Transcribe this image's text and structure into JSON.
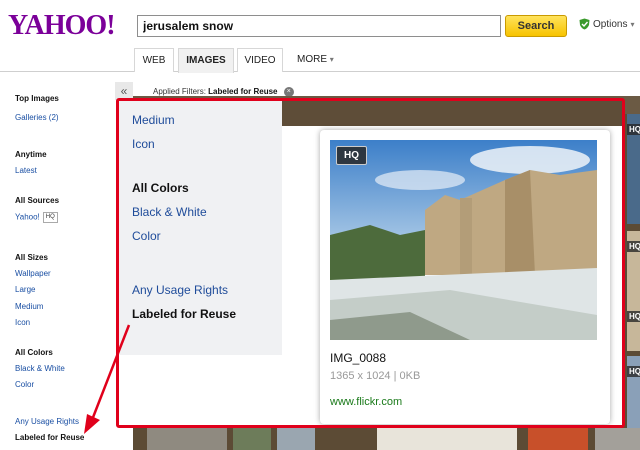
{
  "header": {
    "logo": "YAHOO!",
    "search_value": "jerusalem snow",
    "search_button": "Search",
    "options": "Options",
    "options_caret": "▾"
  },
  "tabs": [
    {
      "label": "WEB"
    },
    {
      "label": "IMAGES"
    },
    {
      "label": "VIDEO"
    }
  ],
  "more_tab": "MORE",
  "more_caret": "▾",
  "collapse_glyph": "«",
  "sidebar": {
    "top_images": "Top Images",
    "galleries": "Galleries (2)",
    "anytime": "Anytime",
    "latest": "Latest",
    "all_sources": "All Sources",
    "yahoo": "Yahoo!",
    "hq": "HQ",
    "all_sizes": "All Sizes",
    "wallpaper": "Wallpaper",
    "large": "Large",
    "medium": "Medium",
    "icon": "Icon",
    "all_colors": "All Colors",
    "black_white": "Black & White",
    "color": "Color",
    "any_usage": "Any Usage Rights",
    "labeled_reuse": "Labeled for Reuse"
  },
  "filters": {
    "label": "Applied Filters:",
    "value": "Labeled for Reuse",
    "close": "×"
  },
  "zoom_menu": {
    "medium": "Medium",
    "icon": "Icon",
    "all_colors": "All Colors",
    "black_white": "Black & White",
    "color": "Color",
    "any_usage": "Any Usage Rights",
    "labeled_reuse": "Labeled for Reuse"
  },
  "card": {
    "hq": "HQ",
    "title": "IMG_0088",
    "meta": "1365 x 1024 | 0KB",
    "url": "www.flickr.com"
  },
  "right_hq": [
    "HQ",
    "HQ",
    "HQ",
    "HQ"
  ],
  "colors": {
    "brand": "#7b0099",
    "highlight_frame": "#e0001b",
    "link": "#1a4fa3",
    "url_green": "#1a7a1a",
    "search_button": "#f7c300"
  }
}
